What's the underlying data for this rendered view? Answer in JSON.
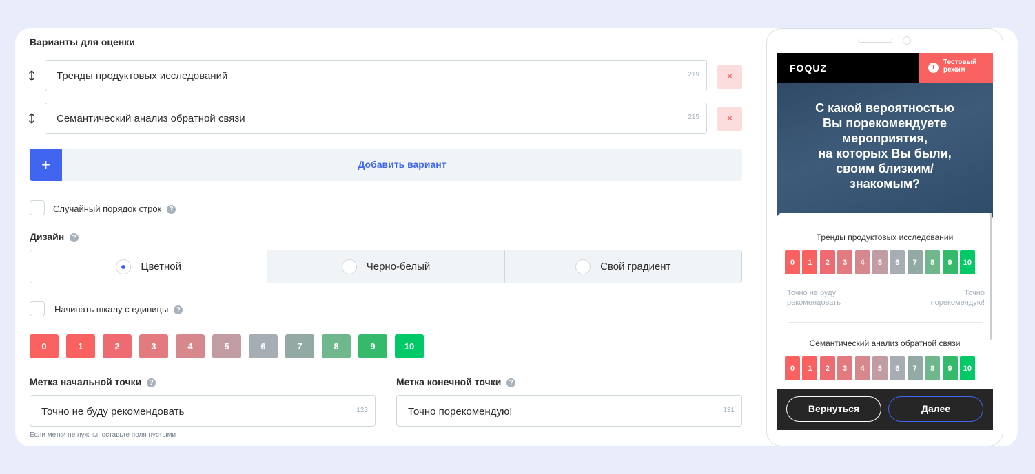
{
  "editor": {
    "options_title": "Варианты для оценки",
    "options": [
      {
        "label": "Тренды продуктовых исследований",
        "count": "219"
      },
      {
        "label": "Семантический анализ обратной связи",
        "count": "215"
      }
    ],
    "add_option_label": "Добавить вариант",
    "add_icon": "+",
    "remove_icon": "×",
    "random_order_label": "Случайный порядок строк",
    "design_title": "Дизайн",
    "design_options": [
      "Цветной",
      "Черно-белый",
      "Свой градиент"
    ],
    "design_selected": "Цветной",
    "start_from_one_label": "Начинать шкалу с единицы",
    "help_icon": "?",
    "scale_values": [
      "0",
      "1",
      "2",
      "3",
      "4",
      "5",
      "6",
      "7",
      "8",
      "9",
      "10"
    ],
    "scale_colors": [
      "#F96261",
      "#F96261",
      "#EE6B71",
      "#E27A7F",
      "#D6888C",
      "#C19CA3",
      "#A6ADB5",
      "#92A9A4",
      "#6FB88C",
      "#35BA6C",
      "#00C968"
    ],
    "start_label_title": "Метка начальной точки",
    "end_label_title": "Метка конечной точки",
    "start_label_value": "Точно не буду рекомендовать",
    "start_label_count": "123",
    "end_label_value": "Точно порекомендую!",
    "end_label_count": "131",
    "labels_hint": "Если метки не нужны, оставьте поля пустыми"
  },
  "preview": {
    "logo": "FOQUZ",
    "test_mode_label": "Тестовый\nрежим",
    "test_icon": "Т",
    "question": "С какой вероятностью\nВы порекомендуете\nмероприятия,\nна которых Вы были,\nсвоим близким/\nзнакомым?",
    "items": [
      "Тренды продуктовых исследований",
      "Семантический анализ обратной связи"
    ],
    "min_label": "Точно не буду\nрекомендовать",
    "max_label": "Точно\nпорекомендую!",
    "back_button": "Вернуться",
    "next_button": "Далее"
  },
  "colors": {
    "accent": "#3F65F1",
    "danger": "#F96261",
    "danger_bg": "#FCDDDE",
    "background": "#E9ECFB"
  }
}
